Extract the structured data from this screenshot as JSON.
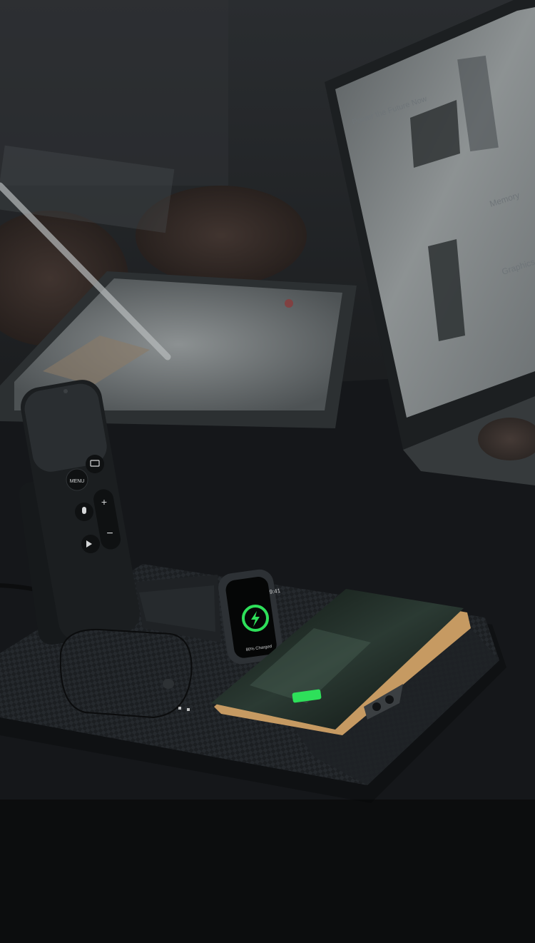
{
  "photo": {
    "remote": {
      "menu_label": "MENU"
    },
    "watch": {
      "time": "9:41",
      "status": "80% Charged"
    },
    "laptop_screen": {
      "heading": "Power the Future Now",
      "word_memory": "Memory",
      "word_graphics": "Graphics"
    }
  },
  "colors": {
    "charge_green": "#2ee05a",
    "background": "#0b0c0d",
    "carbon": "#1c1f22"
  }
}
